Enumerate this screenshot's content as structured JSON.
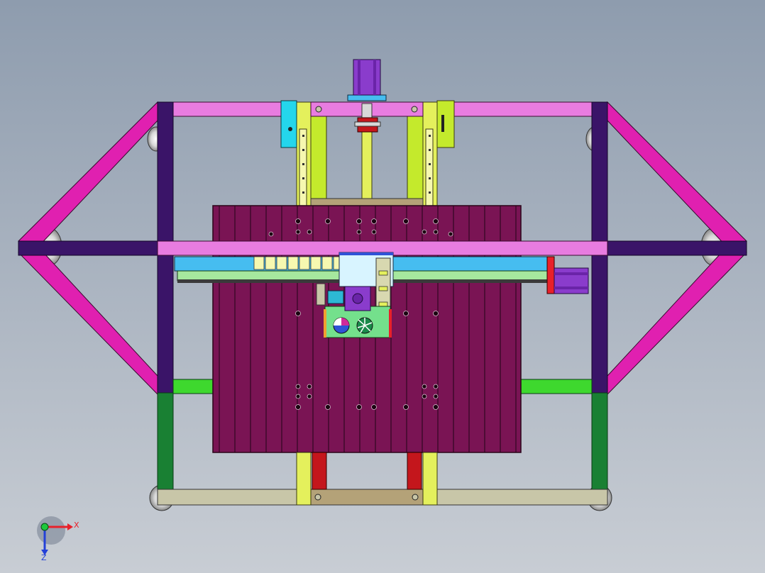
{
  "viewport": {
    "background_top": "#8e9cae",
    "background_bottom": "#c8cdd4"
  },
  "triad": {
    "x_label": "X",
    "z_label": "Z",
    "x_color": "#e8202a",
    "z_color": "#2340d8",
    "y_color": "#1ec83c"
  },
  "colors": {
    "frame_purple": "#3a1468",
    "frame_pink": "#e87ce0",
    "brace_magenta": "#e020b0",
    "frame_green": "#198033",
    "frame_lime": "#3ed82e",
    "frame_khaki": "#c8c6a8",
    "bed_plate": "#7a1454",
    "rail_yellow": "#e4f05c",
    "rail_lime": "#c4ea2c",
    "gantry_blue": "#46bdf0",
    "cyan_block": "#24d6ec",
    "motor_violet": "#8a3ccc",
    "leg_red": "#c4161c",
    "carriage_green": "#74e08c",
    "olive_tan": "#b4a278"
  }
}
